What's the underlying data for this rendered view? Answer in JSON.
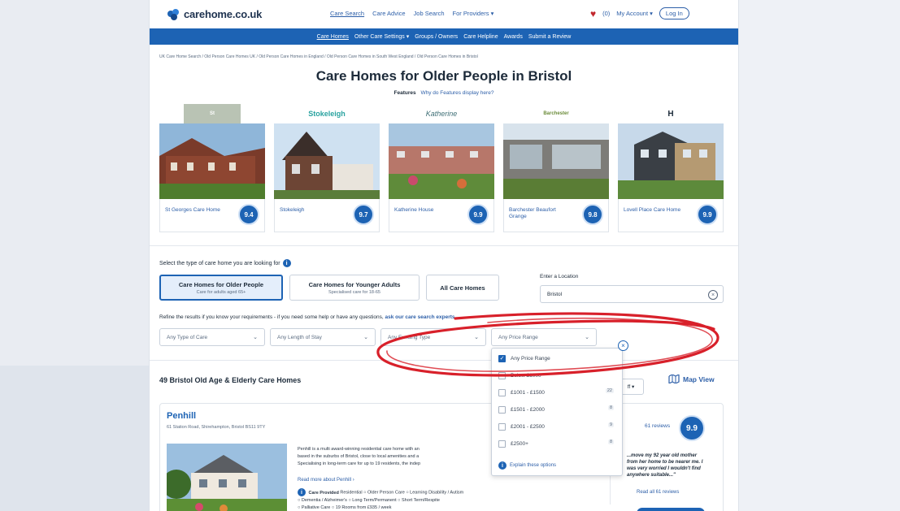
{
  "header": {
    "logo_text": "carehome.co.uk",
    "nav": [
      "Care Search",
      "Care Advice",
      "Job Search",
      "For Providers ▾"
    ],
    "favourites_count": "(0)",
    "my_account": "My Account ▾",
    "login": "Log In"
  },
  "subnav": [
    "Care Homes",
    "Other Care Settings ▾",
    "Groups / Owners",
    "Care Helpline",
    "Awards",
    "Submit a Review"
  ],
  "breadcrumb": "UK Care Home Search  /  Old Person Care Homes UK  /  Old Person Care Homes in England  /  Old Person Care Homes in South West England  /  Old Person Care Homes in Bristol",
  "title": "Care Homes for Older People in Bristol",
  "features": {
    "label": "Features",
    "link": "Why do Features display here?"
  },
  "featured": [
    {
      "logo": "St",
      "name": "St Georges Care Home",
      "score": "9.4"
    },
    {
      "logo": "Stokeleigh",
      "name": "Stokeleigh",
      "score": "9.7"
    },
    {
      "logo": "Katherine",
      "name": "Katherine House",
      "score": "9.9"
    },
    {
      "logo": "Barchester",
      "name": "Barchester Beaufort Grange",
      "score": "9.8"
    },
    {
      "logo": "H",
      "name": "Lovell Place Care Home",
      "score": "9.9"
    }
  ],
  "selector": {
    "prompt": "Select the type of care home you are looking for",
    "types": [
      {
        "title": "Care Homes for Older People",
        "sub": "Care for adults aged 65+"
      },
      {
        "title": "Care Homes for Younger Adults",
        "sub": "Specialised care for 18-65"
      },
      {
        "title": "All Care Homes",
        "sub": ""
      }
    ],
    "location_label": "Enter a Location",
    "location_value": "Bristol",
    "refine_text": "Refine the results if you know your requirements - if you need some help or have any questions,",
    "refine_link": "ask our care search experts.",
    "dropdowns": [
      "Any Type of Care",
      "Any Length of Stay",
      "Any Funding Type",
      "Any Price Range"
    ]
  },
  "price_popup": {
    "options": [
      {
        "label": "Any Price Range",
        "checked": true,
        "count": ""
      },
      {
        "label": "Below £1000",
        "checked": false,
        "count": ""
      },
      {
        "label": "£1001 - £1500",
        "checked": false,
        "count": "22"
      },
      {
        "label": "£1501 - £2000",
        "checked": false,
        "count": "8"
      },
      {
        "label": "£2001 - £2500",
        "checked": false,
        "count": "9"
      },
      {
        "label": "£2500+",
        "checked": false,
        "count": "8"
      }
    ],
    "explain": "Explain these options"
  },
  "results": {
    "heading": "49 Bristol Old Age & Elderly Care Homes",
    "map_view": "Map View",
    "sort": "ff ▾"
  },
  "listing": {
    "name": "Penhill",
    "address": "61 Station Road, Shirehampton, Bristol BS11 9TY",
    "desc1": "Penhill is a multi award-winning residential care home with an",
    "desc2": "based in the suburbs of Bristol, close to local amenities and a",
    "desc3": "Specialising in long-term care for up to 19 residents, the indep",
    "read_more": "Read more about Penhill ›",
    "care_label": "Care Provided",
    "care_line1": "Residential  ○ Older Person Care  ○ Learning Disability / Autism",
    "care_line2": "○ Dementia / Alzheimer's  ○ Long Term/Permanent  ○ Short Term/Respite",
    "care_line3": "○ Palliative Care  ○ 19 Rooms from £935 / week",
    "reviews": "61 reviews",
    "score": "9.9",
    "quote": "...move my 92 year old mother from her home to be nearer me. I was very worried I wouldn't find anywhere suitable...\"",
    "read_all": "Read all 61 reviews"
  },
  "colors": {
    "brand": "#1d63b4",
    "annotation": "#d8202a"
  }
}
